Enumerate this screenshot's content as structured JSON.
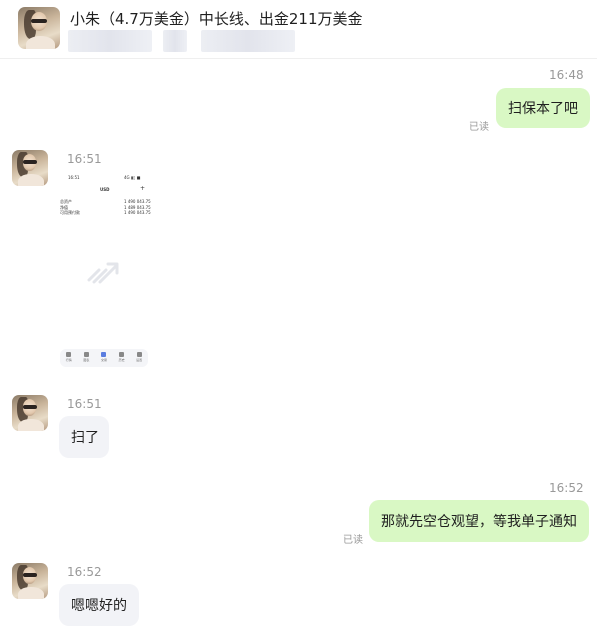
{
  "header": {
    "title": "小朱（4.7万美金）中长线、出金211万美金"
  },
  "messages": [
    {
      "time": "16:48",
      "text": "扫保本了吧",
      "status": "已读"
    },
    {
      "time": "16:51",
      "screenshot": {
        "time": "16:51",
        "status_icons": "4G ▮▯ ■",
        "currency": "USD",
        "add_icon": "+",
        "rows": [
          {
            "label": "总资产",
            "value": "1 490 043.75"
          },
          {
            "label": "净值",
            "value": "1 489 043.75"
          },
          {
            "label": "可用预付款",
            "value": "1 490 043.75"
          }
        ],
        "nav": [
          "行情",
          "图表",
          "交易",
          "历史",
          "设置"
        ]
      }
    },
    {
      "time": "16:51",
      "text": "扫了"
    },
    {
      "time": "16:52",
      "text": "那就先空仓观望，等我单子通知",
      "status": "已读"
    },
    {
      "time": "16:52",
      "text": "嗯嗯好的"
    }
  ],
  "colors": {
    "outgoing_bubble": "#d9f8c4",
    "incoming_bubble": "#f2f3f7",
    "meta_text": "#999999"
  }
}
